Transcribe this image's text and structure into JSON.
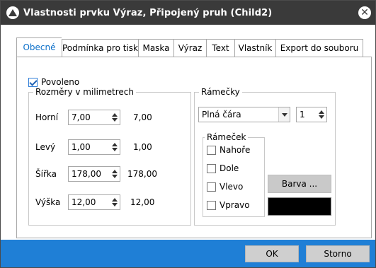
{
  "window": {
    "title": "Vlastnosti prvku Výraz, Připojený pruh (Child2)",
    "close_glyph": "✕"
  },
  "tabs": [
    {
      "label": "Obecné",
      "active": true
    },
    {
      "label": "Podmínka pro tisk",
      "active": false
    },
    {
      "label": "Maska",
      "active": false
    },
    {
      "label": "Výraz",
      "active": false
    },
    {
      "label": "Text",
      "active": false
    },
    {
      "label": "Vlastník",
      "active": false
    },
    {
      "label": "Export do souboru",
      "active": false
    }
  ],
  "general": {
    "enabled_label": "Povoleno",
    "enabled_checked": true,
    "dimensions": {
      "legend": "Rozměry v milimetrech",
      "rows": [
        {
          "label": "Horní",
          "value": "7,00",
          "readout": "7,00"
        },
        {
          "label": "Levý",
          "value": "1,00",
          "readout": "1,00"
        },
        {
          "label": "Šířka",
          "value": "178,00",
          "readout": "178,00"
        },
        {
          "label": "Výška",
          "value": "12,00",
          "readout": "12,00"
        }
      ]
    },
    "frames": {
      "legend": "Rámečky",
      "style_value": "Plná čára",
      "width_value": "1",
      "frame_group": {
        "legend": "Rámeček",
        "options": [
          {
            "label": "Nahoře",
            "checked": false
          },
          {
            "label": "Dole",
            "checked": false
          },
          {
            "label": "Vlevo",
            "checked": false
          },
          {
            "label": "Vpravo",
            "checked": false
          }
        ]
      },
      "color_button_label": "Barva ...",
      "color_value": "#000000"
    }
  },
  "footer": {
    "ok_label": "OK",
    "cancel_label": "Storno"
  },
  "colors": {
    "title_bar": "#3a3a3a",
    "accent_blue": "#1f7fd6",
    "active_tab_text": "#0b6fc9"
  }
}
